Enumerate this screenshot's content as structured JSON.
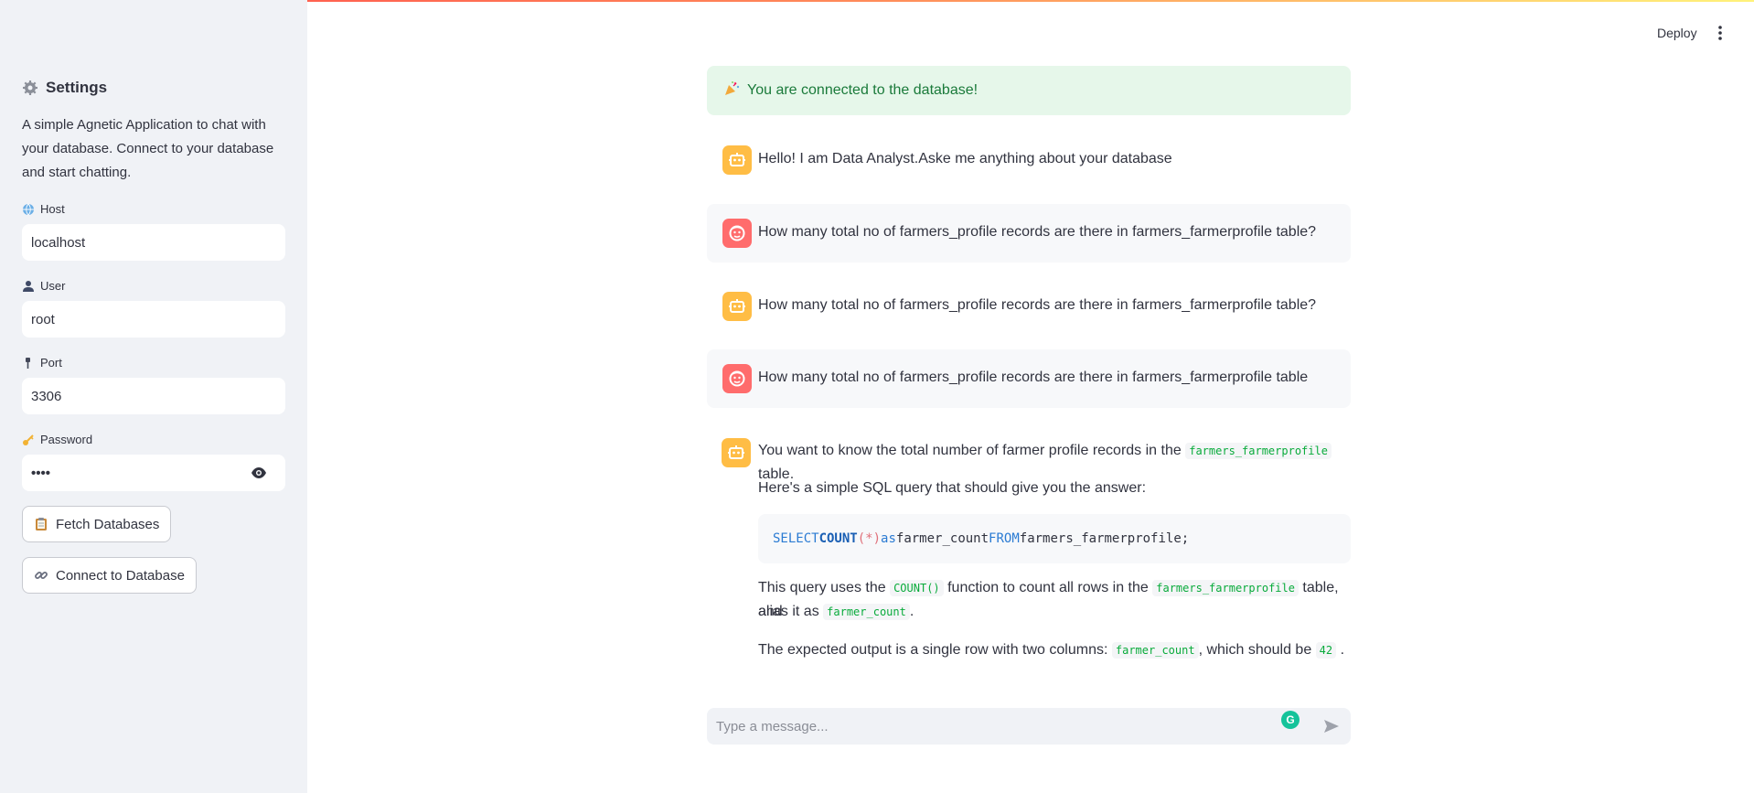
{
  "sidebar": {
    "title": "Settings",
    "description": "A simple Agnetic Application to chat with your database. Connect to your database and start chatting.",
    "fields": {
      "host": {
        "label": "Host",
        "value": "localhost",
        "icon": "globe-icon"
      },
      "user": {
        "label": "User",
        "value": "root",
        "icon": "user-icon"
      },
      "port": {
        "label": "Port",
        "value": "3306",
        "icon": "pin-icon"
      },
      "password": {
        "label": "Password",
        "value": "••••",
        "icon": "key-icon"
      }
    },
    "buttons": {
      "fetch": "Fetch Databases",
      "connect": "Connect to Database"
    }
  },
  "header": {
    "deploy": "Deploy"
  },
  "chat": {
    "success": "You are connected to the database!",
    "messages": [
      {
        "role": "assistant",
        "text": "Hello! I am Data Analyst.Aske me anything about your database"
      },
      {
        "role": "user",
        "text": "How many total no of farmers_profile records are there in farmers_farmerprofile table?"
      },
      {
        "role": "assistant",
        "text": "How many total no of farmers_profile records are there in farmers_farmerprofile table?"
      },
      {
        "role": "user",
        "text": "How many total no of farmers_profile records are there in farmers_farmerprofile table"
      }
    ],
    "final": {
      "line1_pre": "You want to know the total number of farmer profile records in the",
      "line1_code": "farmers_farmerprofile",
      "line1_post": "table.",
      "line2": "Here's a simple SQL query that should give you the answer:",
      "sql": {
        "select": "SELECT",
        "count": "COUNT",
        "paren": "(*)",
        "as": "as",
        "alias": "farmer_count",
        "from": "FROM",
        "table": "farmers_farmerprofile;"
      },
      "line3_a": "This query uses the",
      "line3_code1": "COUNT()",
      "line3_b": "function to count all rows in the",
      "line3_code2": "farmers_farmerprofile",
      "line3_c": "table, and",
      "line4_a": "alias it as",
      "line4_code": "farmer_count",
      "line4_b": ".",
      "line5_a": "The expected output is a single row with two columns:",
      "line5_code1": "farmer_count",
      "line5_b": ", which should be",
      "line5_code2": "42",
      "line5_c": "."
    },
    "input_placeholder": "Type a message..."
  }
}
